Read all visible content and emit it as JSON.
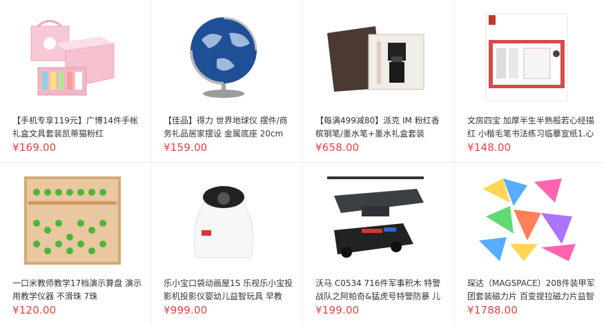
{
  "products": [
    {
      "title": "【手机专享119元】广博14件手帐礼盒文具套装凯蒂猫粉红",
      "price": "¥169.00",
      "image": "pink-stationery-gift-box"
    },
    {
      "title": "【佳品】得力 世界地球仪 摆件/商务礼品居家摆设 金属底座 20cm",
      "price": "¥159.00",
      "image": "globe"
    },
    {
      "title": "【每满499减80】派克 IM 粉红香槟钢笔/墨水笔+墨水礼盒套装",
      "price": "¥658.00",
      "image": "pen-gift-box"
    },
    {
      "title": "文房四宝 加厚半生半熟般若心经描红 小楷毛笔书法练习临摹宣纸1.心",
      "price": "¥148.00",
      "image": "calligraphy-set"
    },
    {
      "title": "一口米教师教学17档演示算盘 演示用教学仪器 不滑珠 7珠",
      "price": "¥120.00",
      "image": "abacus"
    },
    {
      "title": "乐小宝口袋动画屋1S 乐视乐小宝投影机投影仪婴幼儿益智玩具 早教",
      "price": "¥999.00",
      "image": "projector"
    },
    {
      "title": "沃马 C0534 716件军事积木 特警战队之阿帕奇&猛虎号特警防暴 儿",
      "price": "¥199.00",
      "image": "helicopter-blocks"
    },
    {
      "title": "琛达（MAGSPACE）208件装甲军团套装磁力片 百变提拉磁力片益智",
      "price": "¥1788.00",
      "image": "magnetic-tiles"
    }
  ]
}
